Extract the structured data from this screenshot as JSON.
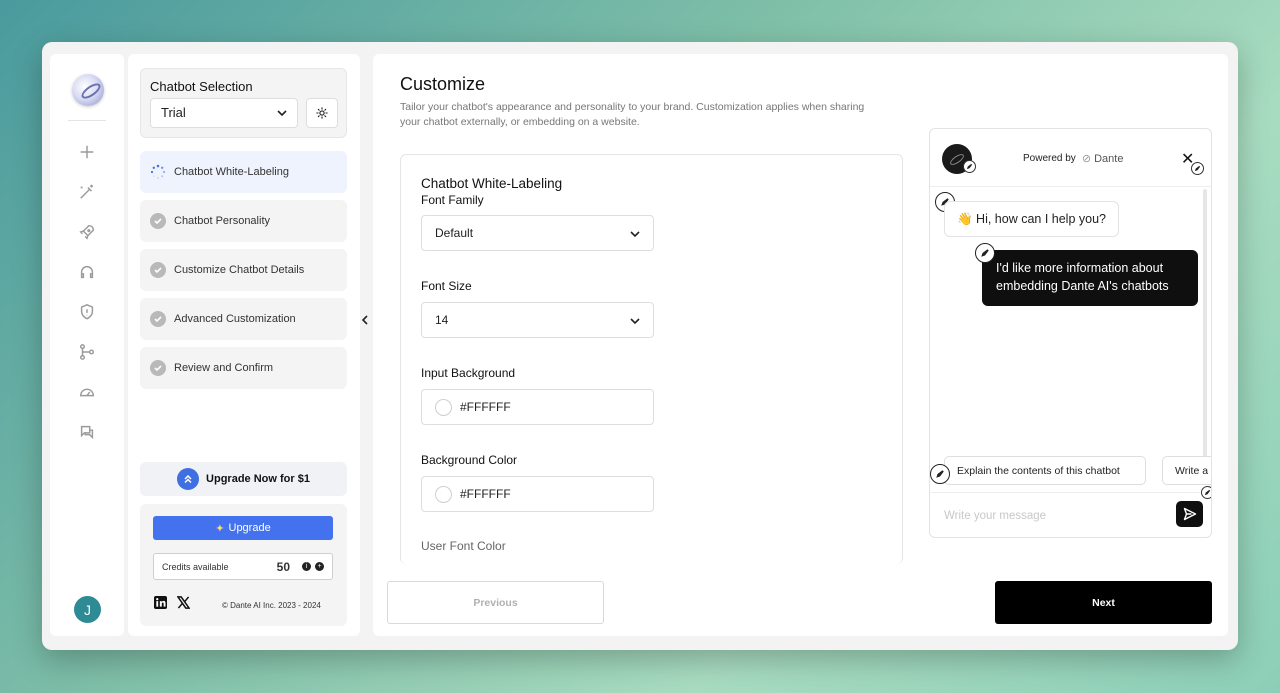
{
  "rail": {
    "icons": [
      "logo-icon",
      "plus-icon",
      "magic-wand-icon",
      "rocket-icon",
      "headset-icon",
      "shield-icon",
      "branch-icon",
      "speedometer-icon",
      "chat-icon"
    ],
    "avatar_initial": "J"
  },
  "sidebar": {
    "selection_label": "Chatbot Selection",
    "selected_chatbot": "Trial",
    "steps": [
      {
        "label": "Chatbot White-Labeling",
        "state": "in-progress"
      },
      {
        "label": "Chatbot Personality",
        "state": "done"
      },
      {
        "label": "Customize Chatbot Details",
        "state": "done"
      },
      {
        "label": "Advanced Customization",
        "state": "done"
      },
      {
        "label": "Review and Confirm",
        "state": "done"
      }
    ],
    "upgrade_banner": "Upgrade Now for $1",
    "upgrade_button": "Upgrade",
    "credits_label": "Credits available",
    "credits_value": "50",
    "copyright": "© Dante AI Inc. 2023 - 2024"
  },
  "main": {
    "title": "Customize",
    "subtitle": "Tailor your chatbot's appearance and personality to your brand. Customization applies when sharing your chatbot externally, or embedding on a website.",
    "section_title": "Chatbot White-Labeling",
    "fields": {
      "font_family_label": "Font Family",
      "font_family_value": "Default",
      "font_size_label": "Font Size",
      "font_size_value": "14",
      "input_bg_label": "Input Background",
      "input_bg_value": "#FFFFFF",
      "bg_color_label": "Background Color",
      "bg_color_value": "#FFFFFF",
      "user_font_color_label": "User Font Color"
    },
    "previous_button": "Previous",
    "next_button": "Next"
  },
  "chat_preview": {
    "powered_by": "Powered by",
    "brand": "Dante",
    "bot_message": "👋 Hi, how can I help you?",
    "user_message": "I'd like more information about embedding Dante AI's chatbots",
    "suggestions": [
      "Explain the contents of this chatbot",
      "Write a"
    ],
    "input_placeholder": "Write your message"
  },
  "colors": {
    "accent_blue": "#4472ee",
    "dark": "#0f0f0f",
    "avatar_teal": "#2e8a94"
  }
}
